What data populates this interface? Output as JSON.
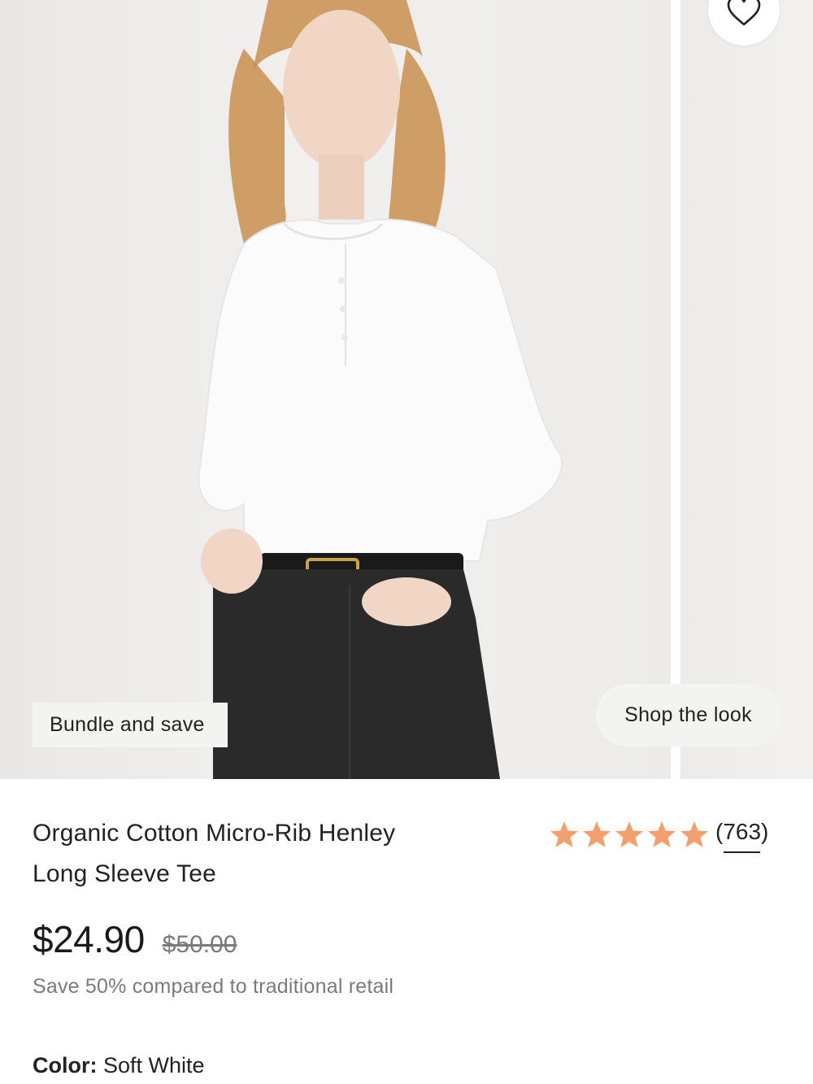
{
  "gallery": {
    "bundle_badge": "Bundle and save",
    "shop_the_look": "Shop the look",
    "favorite_icon": "heart-icon"
  },
  "product": {
    "title_line1": "Organic Cotton Micro-Rib Henley",
    "title_line2": "Long Sleeve Tee",
    "rating": {
      "stars": 5,
      "review_count": "(763)",
      "star_color": "#f4a06d"
    },
    "price": {
      "current": "$24.90",
      "original": "$50.00"
    },
    "savings": "Save 50% compared to traditional retail",
    "color": {
      "label": "Color:",
      "value": "Soft White"
    }
  }
}
